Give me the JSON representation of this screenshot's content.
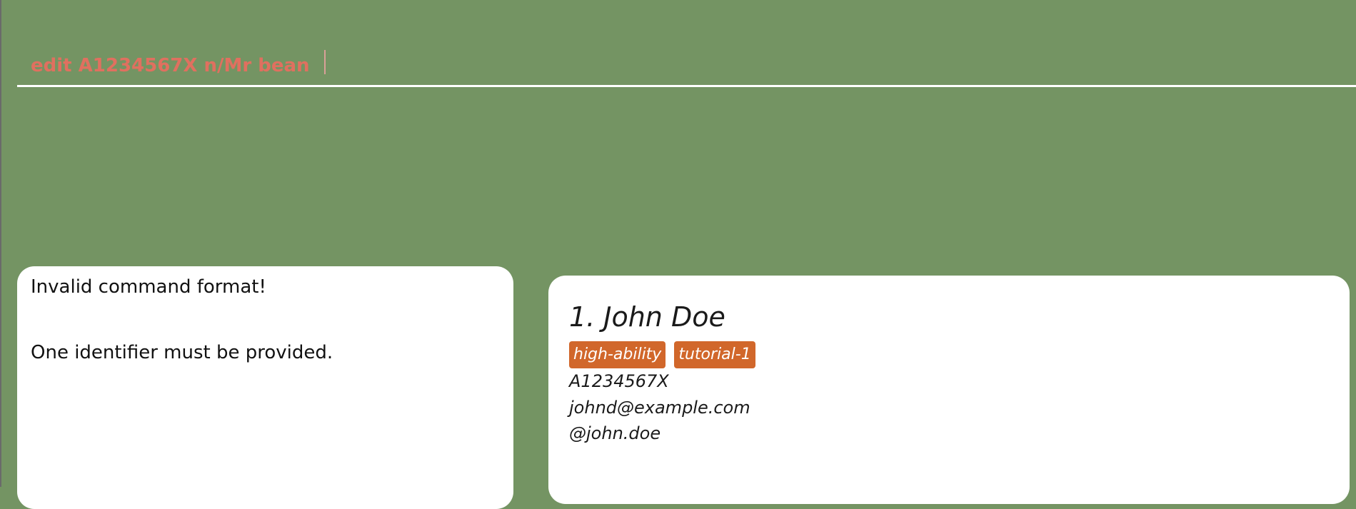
{
  "command": {
    "value": "edit A1234567X n/Mr bean"
  },
  "result": {
    "line1": "Invalid command format!",
    "line2": "One identifier must be provided."
  },
  "persons": [
    {
      "index": "1.",
      "name": "John Doe",
      "tags": [
        "high-ability",
        "tutorial-1"
      ],
      "student_id": "A1234567X",
      "email": "johnd@example.com",
      "telegram": "@john.doe"
    }
  ],
  "colors": {
    "background": "#749463",
    "command_text": "#e0705f",
    "tag": "#d1672b"
  }
}
